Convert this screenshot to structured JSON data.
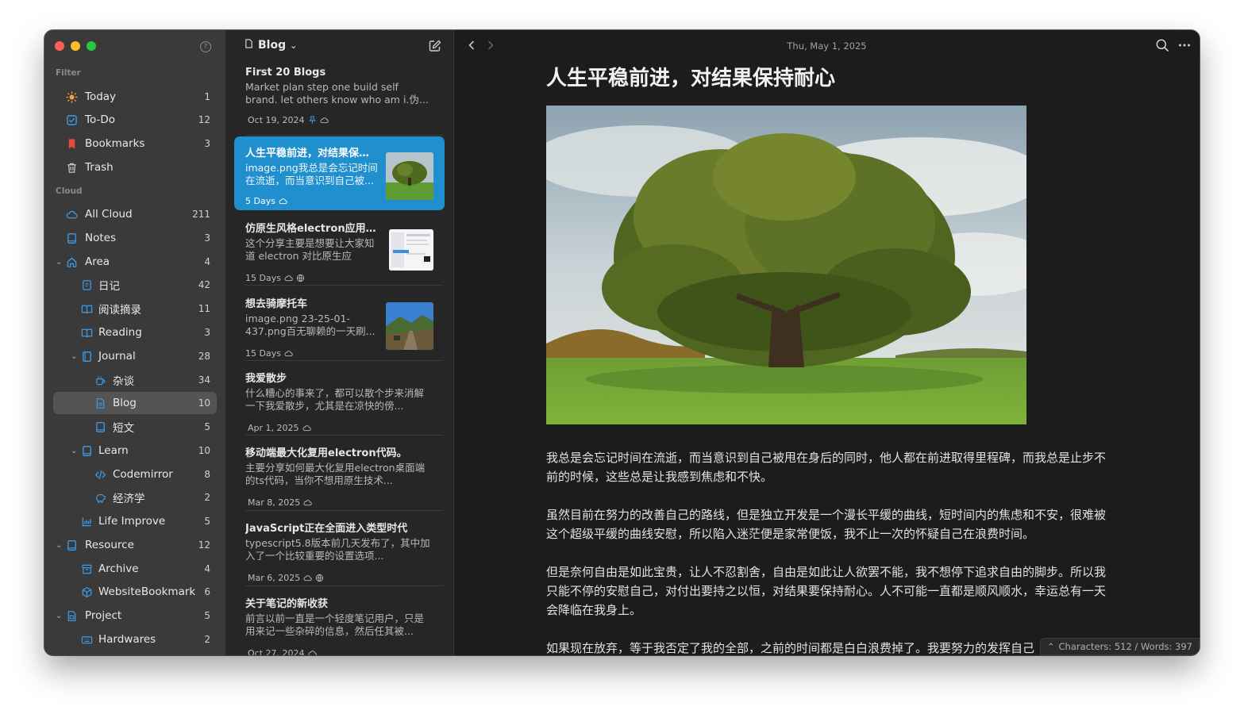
{
  "sidebar": {
    "section_filter": "Filter",
    "section_cloud": "Cloud",
    "items": [
      {
        "label": "Today",
        "count": "1"
      },
      {
        "label": "To-Do",
        "count": "12"
      },
      {
        "label": "Bookmarks",
        "count": "3"
      },
      {
        "label": "Trash",
        "count": ""
      },
      {
        "label": "All Cloud",
        "count": "211"
      },
      {
        "label": "Notes",
        "count": "3"
      },
      {
        "label": "Area",
        "count": "4"
      },
      {
        "label": "日记",
        "count": "42"
      },
      {
        "label": "阅读摘录",
        "count": "11"
      },
      {
        "label": "Reading",
        "count": "3"
      },
      {
        "label": "Journal",
        "count": "28"
      },
      {
        "label": "杂谈",
        "count": "34"
      },
      {
        "label": "Blog",
        "count": "10"
      },
      {
        "label": "短文",
        "count": "5"
      },
      {
        "label": "Learn",
        "count": "10"
      },
      {
        "label": "Codemirror",
        "count": "8"
      },
      {
        "label": "经济学",
        "count": "2"
      },
      {
        "label": "Life Improve",
        "count": "5"
      },
      {
        "label": "Resource",
        "count": "12"
      },
      {
        "label": "Archive",
        "count": "4"
      },
      {
        "label": "WebsiteBookmark",
        "count": "6"
      },
      {
        "label": "Project",
        "count": "5"
      },
      {
        "label": "Hardwares",
        "count": "2"
      }
    ]
  },
  "list": {
    "title": "Blog",
    "notes": [
      {
        "title": "First 20 Blogs",
        "body": "Market plan step one build self brand. let others know who am i.伪...",
        "date": "Oct 19, 2024"
      },
      {
        "title": "人生平稳前进，对结果保持...",
        "body": "image.png我总是会忘记时间在流逝，而当意识到自己被...",
        "date": "5 Days"
      },
      {
        "title": "仿原生风格electron应用的...",
        "body": "这个分享主要是想要让大家知道 electron 对比原生应用，...",
        "date": "15 Days"
      },
      {
        "title": "想去骑摩托车",
        "body": "image.png 23-25-01-437.png百无聊赖的一天刷...",
        "date": "15 Days"
      },
      {
        "title": "我爱散步",
        "body": "什么糟心的事来了，都可以散个步来消解一下我爱散步，尤其是在凉快的傍...",
        "date": "Apr 1, 2025"
      },
      {
        "title": "移动端最大化复用electron代码。",
        "body": "主要分享如何最大化复用electron桌面端的ts代码，当你不想用原生技术...",
        "date": "Mar 8, 2025"
      },
      {
        "title": "JavaScript正在全面进入类型时代",
        "body": "typescript5.8版本前几天发布了，其中加入了一个比较重要的设置选项...",
        "date": "Mar 6, 2025"
      },
      {
        "title": "关于笔记的新收获",
        "body": "前言以前一直是一个轻度笔记用户，只是用来记一些杂碎的信息，然后任其被...",
        "date": "Oct 27, 2024"
      }
    ]
  },
  "editor": {
    "date": "Thu, May 1, 2025",
    "title": "人生平稳前进，对结果保持耐心",
    "paragraphs": [
      "我总是会忘记时间在流逝，而当意识到自己被甩在身后的同时，他人都在前进取得里程碑，而我总是止步不前的时候，这些总是让我感到焦虑和不快。",
      "虽然目前在努力的改善自己的路线，但是独立开发是一个漫长平缓的曲线，短时间内的焦虑和不安，很难被这个超级平缓的曲线安慰，所以陷入迷茫便是家常便饭，我不止一次的怀疑自己在浪费时间。",
      "但是奈何自由是如此宝贵，让人不忍割舍，自由是如此让人欲罢不能，我不想停下追求自由的脚步。所以我只能不停的安慰自己，对付出要持之以恒，对结果要保持耐心。人不可能一直都是顺风顺水，幸运总有一天会降临在我身上。",
      "如果现在放弃，等于我否定了我的全部，之前的时间都是白白浪费掉了。我要努力的发挥自己"
    ],
    "status": "Characters: 512 / Words: 397"
  },
  "colors": {
    "selection": "#1f8fce",
    "accent_blue": "#3c9be8",
    "bookmark_red": "#e8493f",
    "today_orange": "#f2a33a"
  }
}
